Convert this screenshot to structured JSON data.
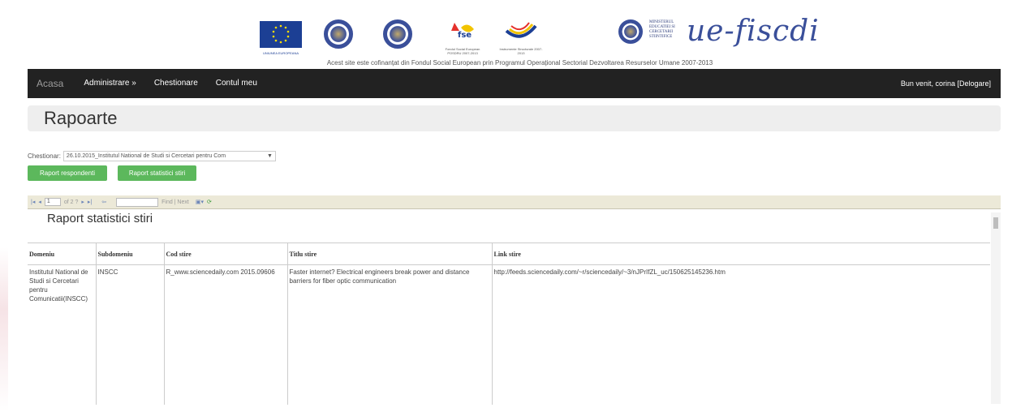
{
  "banner": {
    "eu_caption": "UNIUNEA EUROPEANA",
    "fse_caption": "Fondul Social European POSDRU 2007-2013",
    "is_caption": "Instrumente Structurale 2007-2013",
    "ministry_text": "MINISTERUL EDUCATIEI SI CERCETARII STIINTIFICE",
    "brand_logo": "ue-fiscdi",
    "text": "Acest site este cofinanțat din Fondul Social European prin Programul Operațional Sectorial Dezvoltarea Resurselor Umane 2007-2013"
  },
  "nav": {
    "brand": "Acasa",
    "items": [
      {
        "label": "Administrare »"
      },
      {
        "label": "Chestionare"
      },
      {
        "label": "Contul meu"
      }
    ],
    "welcome": "Bun venit, corina [Delogare]"
  },
  "page": {
    "title": "Rapoarte"
  },
  "filter": {
    "label": "Chestionar:",
    "selected": "26.10.2015_Institutul National de Studi si Cercetari pentru Com"
  },
  "buttons": {
    "respondenti": "Raport respondenti",
    "statistici": "Raport statistici stiri"
  },
  "toolbar": {
    "page_value": "1",
    "page_of": "of 2 ?",
    "find": "Find | Next"
  },
  "report": {
    "title": "Raport statistici stiri",
    "columns": [
      "Domeniu",
      "Subdomeniu",
      "Cod stire",
      "Titlu stire",
      "Link stire"
    ],
    "rows": [
      {
        "domeniu": "Institutul National de Studi si Cercetari pentru Comunicatii(INSCC)",
        "subdomeniu": "INSCC",
        "cod": "R_www.sciencedaily.com 2015.09606",
        "titlu": "Faster internet? Electrical engineers break power and distance barriers for fiber optic communication",
        "link": "http://feeds.sciencedaily.com/~r/sciencedaily/~3/nJPrIfZL_uc/150625145236.htm"
      }
    ]
  }
}
